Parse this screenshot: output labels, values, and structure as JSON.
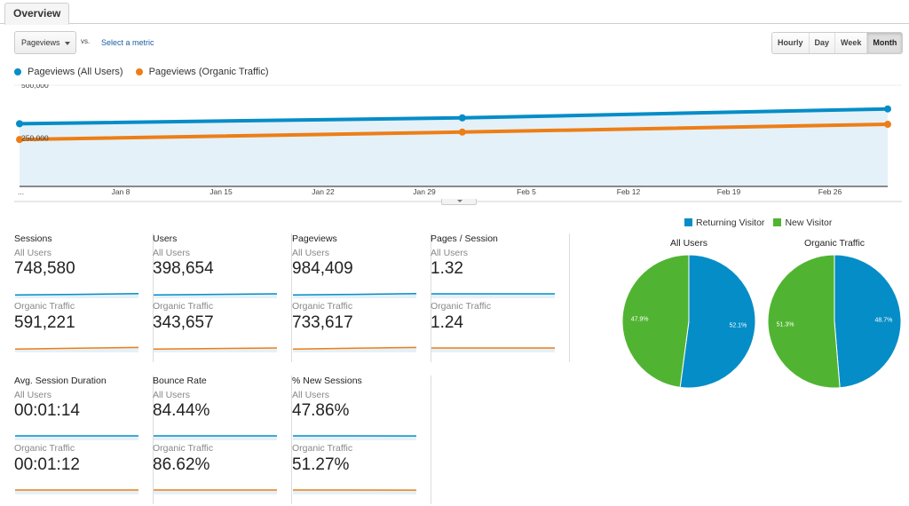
{
  "tabs": [
    {
      "label": "Overview",
      "active": true
    }
  ],
  "toolbar": {
    "metric_select": "Pageviews",
    "vs_label": "vs.",
    "select_metric_link": "Select a metric",
    "granularity": [
      {
        "label": "Hourly",
        "active": false
      },
      {
        "label": "Day",
        "active": false
      },
      {
        "label": "Week",
        "active": false
      },
      {
        "label": "Month",
        "active": true
      }
    ]
  },
  "colors": {
    "blue": "#058dc7",
    "orange": "#ed7e17",
    "green": "#50b432",
    "area": "#e5f1f8"
  },
  "chart_data": [
    {
      "type": "line",
      "title": "",
      "series": [
        {
          "name": "Pageviews (All Users)",
          "color": "#058dc7",
          "values": [
            330000,
            361000,
            408000
          ]
        },
        {
          "name": "Pageviews (Organic Traffic)",
          "color": "#ed7e17",
          "values": [
            247000,
            286000,
            327000
          ]
        }
      ],
      "x_fractions": [
        0,
        0.51,
        1
      ],
      "x_ticks": [
        "...",
        "Jan 8",
        "Jan 15",
        "Jan 22",
        "Jan 29",
        "Feb 5",
        "Feb 12",
        "Feb 19",
        "Feb 26"
      ],
      "y_ticks": [
        "500,000",
        "250,000"
      ],
      "ylim": [
        0,
        500000
      ],
      "legend": "top-left",
      "grid": true
    },
    {
      "type": "pie",
      "title": "All Users",
      "categories": [
        "Returning Visitor",
        "New Visitor"
      ],
      "values": [
        52.1,
        47.9
      ],
      "labels": [
        "52.1%",
        "47.9%"
      ],
      "colors": [
        "#058dc7",
        "#50b432"
      ]
    },
    {
      "type": "pie",
      "title": "Organic Traffic",
      "categories": [
        "Returning Visitor",
        "New Visitor"
      ],
      "values": [
        48.7,
        51.3
      ],
      "labels": [
        "48.7%",
        "51.3%"
      ],
      "colors": [
        "#058dc7",
        "#50b432"
      ]
    }
  ],
  "pie_legend": [
    {
      "label": "Returning Visitor",
      "color": "#058dc7"
    },
    {
      "label": "New Visitor",
      "color": "#50b432"
    }
  ],
  "metrics": [
    {
      "title": "Sessions",
      "all_label": "All Users",
      "all_value": "748,580",
      "org_label": "Organic Traffic",
      "org_value": "591,221",
      "all_trend": [
        0.3,
        0.4,
        0.55
      ],
      "org_trend": [
        0.3,
        0.45,
        0.6
      ]
    },
    {
      "title": "Users",
      "all_label": "All Users",
      "all_value": "398,654",
      "org_label": "Organic Traffic",
      "org_value": "343,657",
      "all_trend": [
        0.3,
        0.4,
        0.5
      ],
      "org_trend": [
        0.3,
        0.4,
        0.5
      ]
    },
    {
      "title": "Pageviews",
      "all_label": "All Users",
      "all_value": "984,409",
      "org_label": "Organic Traffic",
      "org_value": "733,617",
      "all_trend": [
        0.3,
        0.4,
        0.55
      ],
      "org_trend": [
        0.3,
        0.45,
        0.6
      ]
    },
    {
      "title": "Pages / Session",
      "all_label": "All Users",
      "all_value": "1.32",
      "org_label": "Organic Traffic",
      "org_value": "1.24",
      "all_trend": [
        0.5,
        0.5,
        0.5
      ],
      "org_trend": [
        0.5,
        0.5,
        0.5
      ]
    },
    {
      "title": "Avg. Session Duration",
      "all_label": "All Users",
      "all_value": "00:01:14",
      "org_label": "Organic Traffic",
      "org_value": "00:01:12",
      "all_trend": [
        0.5,
        0.5,
        0.5
      ],
      "org_trend": [
        0.5,
        0.5,
        0.5
      ]
    },
    {
      "title": "Bounce Rate",
      "all_label": "All Users",
      "all_value": "84.44%",
      "org_label": "Organic Traffic",
      "org_value": "86.62%",
      "all_trend": [
        0.5,
        0.5,
        0.5
      ],
      "org_trend": [
        0.5,
        0.5,
        0.5
      ]
    },
    {
      "title": "% New Sessions",
      "all_label": "All Users",
      "all_value": "47.86%",
      "org_label": "Organic Traffic",
      "org_value": "51.27%",
      "all_trend": [
        0.5,
        0.5,
        0.48
      ],
      "org_trend": [
        0.5,
        0.5,
        0.48
      ]
    }
  ]
}
